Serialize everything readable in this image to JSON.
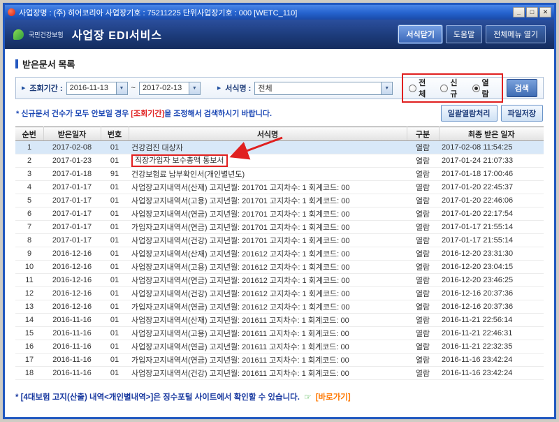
{
  "colors": {
    "titlebar_blue": "#2158C0",
    "header_navy": "#1C3B7A",
    "annotation_red": "#E02020",
    "selected_row_blue": "#D8E8F8",
    "notice_blue": "#1A46B4",
    "link_orange": "#FF7800",
    "logo_green": "#2E9E3E"
  },
  "window": {
    "title": "사업장명 : (주) 히어코리아 사업장기호 : 75211225 단위사업장기호 : 000 [WETC_110]",
    "controls": {
      "minimize": "_",
      "maximize": "□",
      "close": "✕"
    }
  },
  "header": {
    "logo_text": "국민건강보험",
    "app_title": "사업장 EDI서비스",
    "buttons": {
      "close_form": "서식닫기",
      "help": "도움말",
      "full_menu": "전체메뉴 열기"
    }
  },
  "section": {
    "title": "받은문서 목록"
  },
  "filters": {
    "period_label": "조회기간 :",
    "date_from": "2016-11-13",
    "date_separator": "~",
    "date_to": "2017-02-13",
    "form_label": "서식명 :",
    "form_value": "전체",
    "radios": [
      {
        "label": "전체",
        "checked": false
      },
      {
        "label": "신규",
        "checked": false
      },
      {
        "label": "열람",
        "checked": true
      }
    ],
    "search_button": "검색"
  },
  "notice": {
    "prefix": "* 신규문서 건수가 모두 안보일 경우 ",
    "highlight": "[조회기간]",
    "suffix": "을 조정해서 검색하시기 바랍니다.",
    "batch_read_button": "일괄열람처리",
    "save_file_button": "파일저장"
  },
  "table": {
    "headers": [
      "순번",
      "받은일자",
      "번호",
      "서식명",
      "구분",
      "최종 받은 일자"
    ],
    "selected_row_no": "1",
    "red_box_row_no": "2",
    "rows": [
      {
        "no": "1",
        "received": "2017-02-08",
        "num": "01",
        "form": "건강검진 대상자",
        "status": "열람",
        "last": "2017-02-08 11:54:25"
      },
      {
        "no": "2",
        "received": "2017-01-23",
        "num": "01",
        "form": "직장가입자 보수총액 통보서",
        "status": "열람",
        "last": "2017-01-24 21:07:33"
      },
      {
        "no": "3",
        "received": "2017-01-18",
        "num": "91",
        "form": "건강보험료 납부확인서(개인별년도)",
        "status": "열람",
        "last": "2017-01-18 17:00:46"
      },
      {
        "no": "4",
        "received": "2017-01-17",
        "num": "01",
        "form": "사업장고지내역서(산재) 고지년월: 201701 고지차수: 1 회계코드: 00",
        "status": "열람",
        "last": "2017-01-20 22:45:37"
      },
      {
        "no": "5",
        "received": "2017-01-17",
        "num": "01",
        "form": "사업장고지내역서(고용) 고지년월: 201701 고지차수: 1 회계코드: 00",
        "status": "열람",
        "last": "2017-01-20 22:46:06"
      },
      {
        "no": "6",
        "received": "2017-01-17",
        "num": "01",
        "form": "사업장고지내역서(연금) 고지년월: 201701 고지차수: 1 회계코드: 00",
        "status": "열람",
        "last": "2017-01-20 22:17:54"
      },
      {
        "no": "7",
        "received": "2017-01-17",
        "num": "01",
        "form": "가입자고지내역서(연금) 고지년월: 201701 고지차수: 1 회계코드: 00",
        "status": "열람",
        "last": "2017-01-17 21:55:14"
      },
      {
        "no": "8",
        "received": "2017-01-17",
        "num": "01",
        "form": "사업장고지내역서(건강) 고지년월: 201701 고지차수: 1 회계코드: 00",
        "status": "열람",
        "last": "2017-01-17 21:55:14"
      },
      {
        "no": "9",
        "received": "2016-12-16",
        "num": "01",
        "form": "사업장고지내역서(산재) 고지년월: 201612 고지차수: 1 회계코드: 00",
        "status": "열람",
        "last": "2016-12-20 23:31:30"
      },
      {
        "no": "10",
        "received": "2016-12-16",
        "num": "01",
        "form": "사업장고지내역서(고용) 고지년월: 201612 고지차수: 1 회계코드: 00",
        "status": "열람",
        "last": "2016-12-20 23:04:15"
      },
      {
        "no": "11",
        "received": "2016-12-16",
        "num": "01",
        "form": "사업장고지내역서(연금) 고지년월: 201612 고지차수: 1 회계코드: 00",
        "status": "열람",
        "last": "2016-12-20 23:46:25"
      },
      {
        "no": "12",
        "received": "2016-12-16",
        "num": "01",
        "form": "사업장고지내역서(건강) 고지년월: 201612 고지차수: 1 회계코드: 00",
        "status": "열람",
        "last": "2016-12-16 20:37:36"
      },
      {
        "no": "13",
        "received": "2016-12-16",
        "num": "01",
        "form": "가입자고지내역서(연금) 고지년월: 201612 고지차수: 1 회계코드: 00",
        "status": "열람",
        "last": "2016-12-16 20:37:36"
      },
      {
        "no": "14",
        "received": "2016-11-16",
        "num": "01",
        "form": "사업장고지내역서(산재) 고지년월: 201611 고지차수: 1 회계코드: 00",
        "status": "열람",
        "last": "2016-11-21 22:56:14"
      },
      {
        "no": "15",
        "received": "2016-11-16",
        "num": "01",
        "form": "사업장고지내역서(고용) 고지년월: 201611 고지차수: 1 회계코드: 00",
        "status": "열람",
        "last": "2016-11-21 22:46:31"
      },
      {
        "no": "16",
        "received": "2016-11-16",
        "num": "01",
        "form": "사업장고지내역서(연금) 고지년월: 201611 고지차수: 1 회계코드: 00",
        "status": "열람",
        "last": "2016-11-21 22:32:35"
      },
      {
        "no": "17",
        "received": "2016-11-16",
        "num": "01",
        "form": "가입자고지내역서(연금) 고지년월: 201611 고지차수: 1 회계코드: 00",
        "status": "열람",
        "last": "2016-11-16 23:42:24"
      },
      {
        "no": "18",
        "received": "2016-11-16",
        "num": "01",
        "form": "사업장고지내역서(건강) 고지년월: 201611 고지차수: 1 회계코드: 00",
        "status": "열람",
        "last": "2016-11-16 23:42:24"
      }
    ]
  },
  "footer": {
    "text": "* [4대보험 고지(산출) 내역<개인별내역>]은 징수포털 사이트에서 확인할 수 있습니다.",
    "link_icon": "☞",
    "link": "[바로가기]"
  }
}
